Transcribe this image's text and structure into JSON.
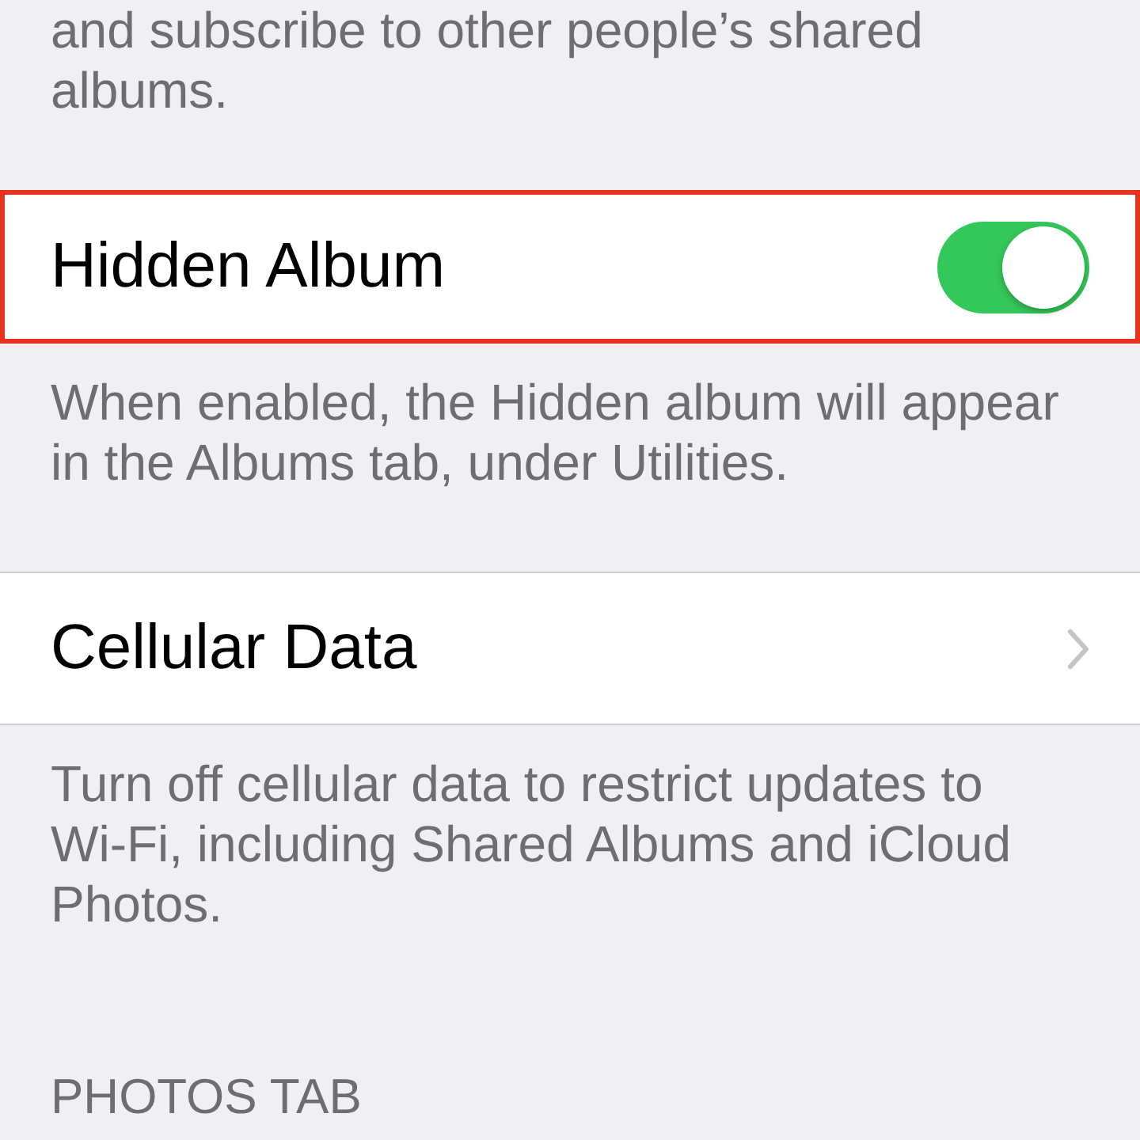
{
  "intro_footer": "and subscribe to other people’s shared albums.",
  "rows": [
    {
      "kind": "toggle",
      "label": "Hidden Album",
      "on": true,
      "highlighted": true,
      "footer": "When enabled, the Hidden album will appear in the Albums tab, under Utilities."
    },
    {
      "kind": "link",
      "label": "Cellular Data",
      "highlighted": false,
      "footer": "Turn off cellular data to restrict updates to Wi-Fi, including Shared Albums and iCloud Photos."
    }
  ],
  "section_header": "PHOTOS TAB"
}
